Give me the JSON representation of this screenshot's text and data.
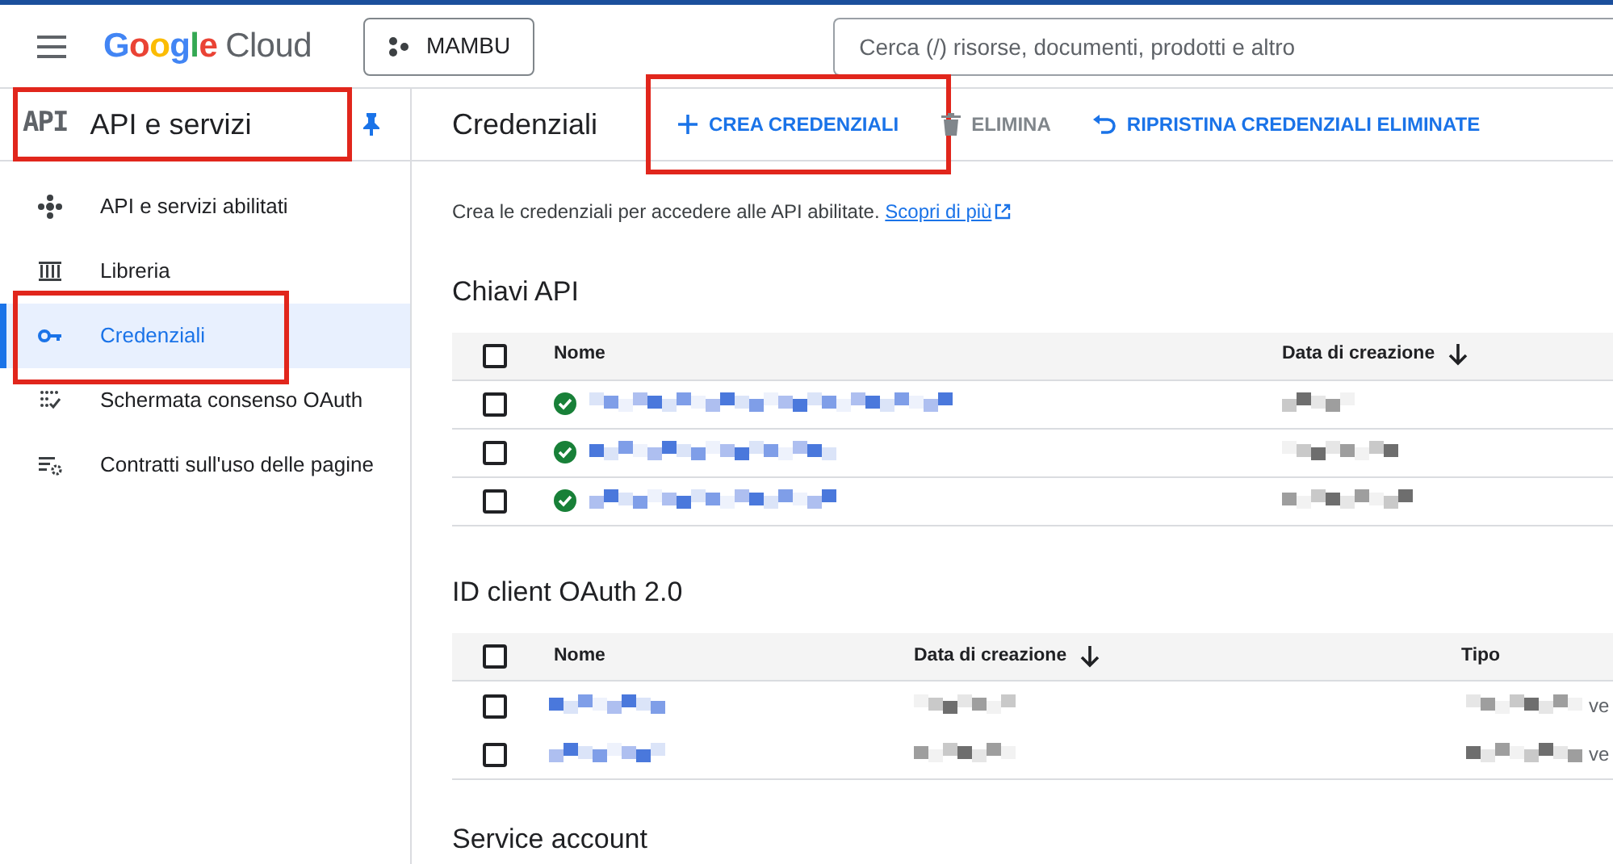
{
  "header": {
    "logo_google": "Google",
    "logo_cloud": "Cloud",
    "project": "MAMBU",
    "search": {
      "placeholder": "Cerca (/) risorse, documenti, prodotti e altro"
    }
  },
  "sidebar": {
    "badge": "API",
    "title": "API e servizi",
    "pinned": true,
    "items": [
      {
        "label": "API e servizi abilitati",
        "kind": "dashboard",
        "selected": false
      },
      {
        "label": "Libreria",
        "kind": "library",
        "selected": false
      },
      {
        "label": "Credenziali",
        "kind": "key",
        "selected": true
      },
      {
        "label": "Schermata consenso OAuth",
        "kind": "consent",
        "selected": false
      },
      {
        "label": "Contratti sull'uso delle pagine",
        "kind": "agreements",
        "selected": false
      }
    ]
  },
  "toolbar": {
    "title": "Credenziali",
    "actions": [
      {
        "label": "CREA CREDENZIALI",
        "kind": "add",
        "disabled": false
      },
      {
        "label": "ELIMINA",
        "kind": "delete",
        "disabled": true
      },
      {
        "label": "RIPRISTINA CREDENZIALI ELIMINATE",
        "kind": "restore",
        "disabled": false
      }
    ]
  },
  "intro": {
    "text": "Crea le credenziali per accedere alle API abilitate.",
    "link": "Scopri di più"
  },
  "api_keys": {
    "title": "Chiavi API",
    "columns": [
      {
        "label": "Nome",
        "sorted": false
      },
      {
        "label": "Data di creazione",
        "sorted": true
      }
    ],
    "select_all": {
      "checked": false
    },
    "rows": [
      {
        "checked": false,
        "ok": true
      },
      {
        "checked": false,
        "ok": true
      },
      {
        "checked": false,
        "ok": true
      }
    ]
  },
  "oauth_clients": {
    "title": "ID client OAuth 2.0",
    "columns": [
      {
        "label": "Nome",
        "sorted": false
      },
      {
        "label": "Data di creazione",
        "sorted": true
      },
      {
        "label": "Tipo",
        "sorted": false
      }
    ],
    "select_all": {
      "checked": false
    },
    "rows": [
      {
        "checked": false,
        "type_tail": "ve"
      },
      {
        "checked": false,
        "type_tail": "ve"
      }
    ]
  },
  "service_accounts": {
    "title": "Service account"
  }
}
